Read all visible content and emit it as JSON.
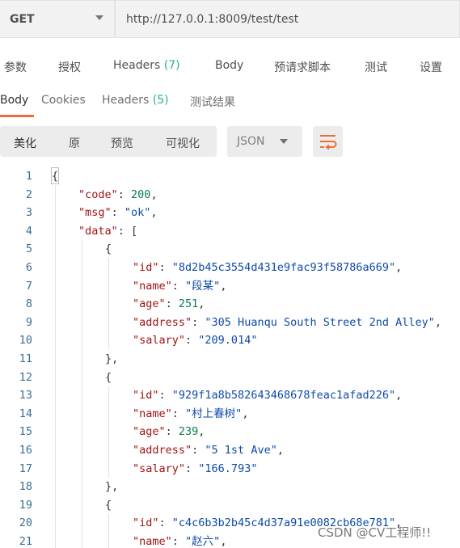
{
  "request": {
    "method": "GET",
    "url": "http://127.0.0.1:8009/test/test"
  },
  "request_tabs": {
    "params": "参数",
    "auth": "授权",
    "headers_label": "Headers",
    "headers_count": "(7)",
    "body": "Body",
    "pre_request_script": "预请求脚本",
    "tests": "测试",
    "settings": "设置"
  },
  "response_tabs": {
    "body": "Body",
    "cookies": "Cookies",
    "headers_label": "Headers",
    "headers_count": "(5)",
    "test_results": "测试结果"
  },
  "toolbar": {
    "pretty": "美化",
    "raw": "原",
    "preview": "预览",
    "visualize": "可视化",
    "language": "JSON",
    "wrap_icon": "wrap-lines-icon"
  },
  "code": {
    "line_numbers": [
      "1",
      "2",
      "3",
      "4",
      "5",
      "6",
      "7",
      "8",
      "9",
      "10",
      "11",
      "12",
      "13",
      "14",
      "15",
      "16",
      "17",
      "18",
      "19",
      "20",
      "21"
    ],
    "l1": "{",
    "l2_key": "\"code\"",
    "l2_sep": ": ",
    "l2_val": "200",
    "l2_end": ",",
    "l3_key": "\"msg\"",
    "l3_sep": ": ",
    "l3_val": "\"ok\"",
    "l3_end": ",",
    "l4_key": "\"data\"",
    "l4_sep": ": ",
    "l4_end": "[",
    "l5": "{",
    "l6_key": "\"id\"",
    "l6_sep": ": ",
    "l6_val": "\"8d2b45c3554d431e9fac93f58786a669\"",
    "l6_end": ",",
    "l7_key": "\"name\"",
    "l7_sep": ": ",
    "l7_val": "\"段某\"",
    "l7_end": ",",
    "l8_key": "\"age\"",
    "l8_sep": ": ",
    "l8_val": "251",
    "l8_end": ",",
    "l9_key": "\"address\"",
    "l9_sep": ": ",
    "l9_val": "\"305 Huanqu South Street 2nd Alley\"",
    "l9_end": ",",
    "l10_key": "\"salary\"",
    "l10_sep": ": ",
    "l10_val": "\"209.014\"",
    "l11": "},",
    "l12": "{",
    "l13_key": "\"id\"",
    "l13_sep": ": ",
    "l13_val": "\"929f1a8b582643468678feac1afad226\"",
    "l13_end": ",",
    "l14_key": "\"name\"",
    "l14_sep": ": ",
    "l14_val": "\"村上春树\"",
    "l14_end": ",",
    "l15_key": "\"age\"",
    "l15_sep": ": ",
    "l15_val": "239",
    "l15_end": ",",
    "l16_key": "\"address\"",
    "l16_sep": ": ",
    "l16_val": "\"5 1st Ave\"",
    "l16_end": ",",
    "l17_key": "\"salary\"",
    "l17_sep": ": ",
    "l17_val": "\"166.793\"",
    "l18": "},",
    "l19": "{",
    "l20_key": "\"id\"",
    "l20_sep": ": ",
    "l20_val": "\"c4c6b3b2b45c4d37a91e0082cb68e781\"",
    "l20_end": ",",
    "l21_key": "\"name\"",
    "l21_sep": ": ",
    "l21_val": "\"赵六\"",
    "l21_end": ","
  },
  "watermark": "CSDN @CV工程师!!",
  "colors": {
    "accent": "#f26b3a",
    "count_green": "#26b47f",
    "json_key": "#a11313",
    "json_string": "#0e4aa8",
    "json_number": "#097c4e"
  }
}
